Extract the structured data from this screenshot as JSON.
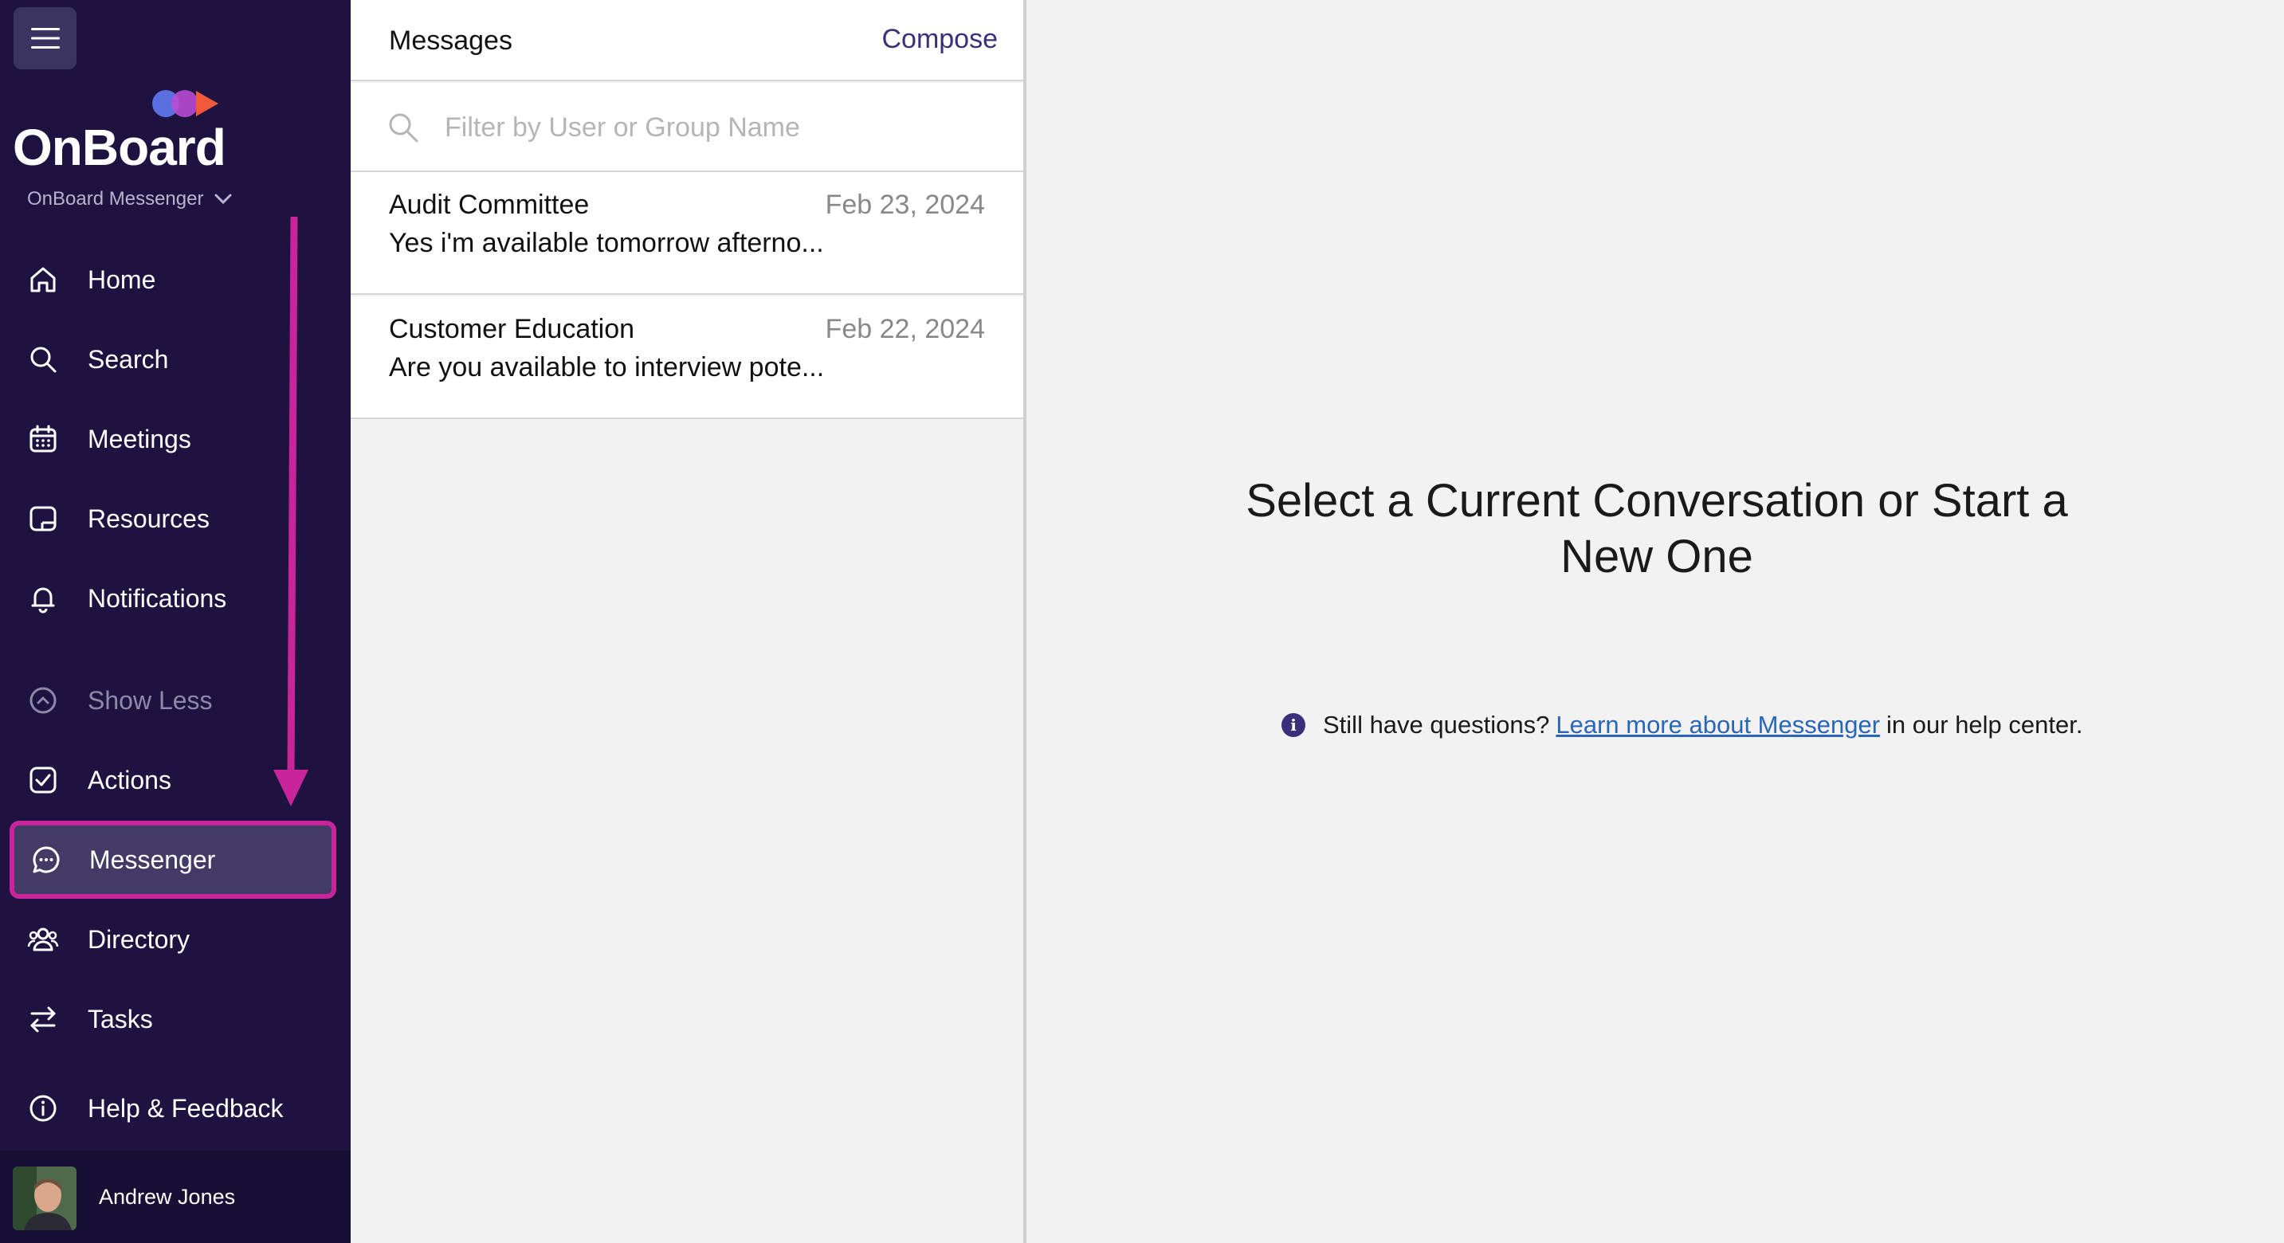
{
  "sidebar": {
    "logo_text": "OnBoard",
    "workspace": "OnBoard Messenger",
    "items": [
      {
        "label": "Home",
        "icon": "home-icon"
      },
      {
        "label": "Search",
        "icon": "search-icon"
      },
      {
        "label": "Meetings",
        "icon": "calendar-icon"
      },
      {
        "label": "Resources",
        "icon": "folder-icon"
      },
      {
        "label": "Notifications",
        "icon": "bell-icon"
      },
      {
        "label": "Show Less",
        "icon": "chevron-up-circle-icon"
      },
      {
        "label": "Actions",
        "icon": "checkbox-icon"
      },
      {
        "label": "Messenger",
        "icon": "chat-bubble-icon",
        "active": true
      },
      {
        "label": "Directory",
        "icon": "people-icon"
      },
      {
        "label": "Tasks",
        "icon": "swap-arrows-icon"
      },
      {
        "label": "Help & Feedback",
        "icon": "info-icon"
      }
    ],
    "user_name": "Andrew Jones"
  },
  "messages": {
    "title": "Messages",
    "compose_label": "Compose",
    "filter_placeholder": "Filter by User or Group Name",
    "conversations": [
      {
        "name": "Audit Committee",
        "date": "Feb 23, 2024",
        "preview": "Yes i'm available tomorrow afterno..."
      },
      {
        "name": "Customer Education",
        "date": "Feb 22, 2024",
        "preview": "Are you available to interview pote..."
      }
    ]
  },
  "main": {
    "title": "Select a Current Conversation or Start a New One",
    "help_prefix": "Still have questions?",
    "help_link": "Learn more about Messenger",
    "help_suffix": "in our help center."
  },
  "colors": {
    "sidebar_bg": "#1e1340",
    "highlight": "#c8259b",
    "accent": "#3b2f7a",
    "link": "#2a66b8"
  }
}
